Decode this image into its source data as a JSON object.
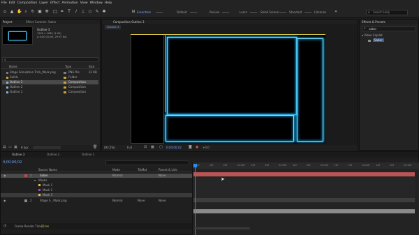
{
  "menu": [
    "File",
    "Edit",
    "Composition",
    "Layer",
    "Effect",
    "Animation",
    "View",
    "Window",
    "Help"
  ],
  "workspaces": [
    "Essentials",
    "Default",
    "Review",
    "Learn",
    "Small Screen",
    "Standard",
    "Libraries"
  ],
  "search_help_placeholder": "Search Help",
  "project_panel": {
    "tab": "Project",
    "effect_controls_tab": "Effect Controls: Saber",
    "selected_item_name": "Outline 3",
    "selected_item_info_1": "1920 x 1080 (1.00)",
    "selected_item_info_2": "Δ 0;00;10;00, 29.97 fps",
    "columns": {
      "name": "Name",
      "type": "Type",
      "size": "Size"
    },
    "items": [
      {
        "name": "Stage Simulation Trick_Mask.png",
        "type": "PNG file",
        "size": "22 KB",
        "color": "#7c7c7c"
      },
      {
        "name": "Solids",
        "type": "Folder",
        "size": "",
        "color": "#c9a33a"
      },
      {
        "name": "Outline 3",
        "type": "Composition",
        "size": "",
        "color": "#c9a33a",
        "selected": true
      },
      {
        "name": "Outline 2",
        "type": "Composition",
        "size": "",
        "color": "#c9a33a"
      },
      {
        "name": "Outline 1",
        "type": "Composition",
        "size": "",
        "color": "#c9a33a"
      }
    ],
    "bpc": "8 bpc"
  },
  "composition_panel": {
    "tab": "Composition Outline 3",
    "sub_tab": "Outline 3",
    "zoom": "(93.5%)",
    "resolution": "Full",
    "time": "0;00;00;02",
    "exposure": "+0.0"
  },
  "effects_panel": {
    "tab": "Effects & Presets",
    "search_value": "saber",
    "category": "Video Copilot",
    "effect": "Saber"
  },
  "timeline": {
    "tabs": [
      "Outline 3",
      "Outline 2",
      "Outline 1"
    ],
    "current_time": "0;00;00;02",
    "columns": {
      "source": "Source Name",
      "mode": "Mode",
      "trkmat": "TrkMat",
      "parent": "Parent & Link"
    },
    "layers": [
      {
        "num": "1",
        "name": "Saber",
        "mode": "Normal",
        "trkmat": "",
        "parent": "None",
        "color": "#c04a4a",
        "selected": true
      },
      {
        "num": "",
        "name": "Masks",
        "mode": "",
        "trkmat": "",
        "parent": "",
        "color": ""
      },
      {
        "num": "",
        "name": "Mask 1",
        "mode": "",
        "trkmat": "",
        "parent": "",
        "color": "#d7c44a"
      },
      {
        "num": "",
        "name": "Mask 2",
        "mode": "",
        "trkmat": "",
        "parent": "",
        "color": "#a64ac0"
      },
      {
        "num": "",
        "name": "Mask 3",
        "mode": "",
        "trkmat": "",
        "parent": "",
        "color": "#d7c44a"
      },
      {
        "num": "2",
        "name": "Stage S…Mask.png",
        "mode": "Normal",
        "trkmat": "None",
        "parent": "None",
        "color": "#8a8a8a"
      }
    ],
    "ruler_ticks": [
      "00f",
      "10f",
      "20f",
      "01:00f",
      "10f",
      "20f",
      "02:00f",
      "10f",
      "20f",
      "03:00f",
      "10f",
      "20f",
      "04:00f",
      "10f",
      "20f",
      "05:00f"
    ],
    "playhead_fraction": 0.006,
    "render_time_label": "Frame Render Time:",
    "render_time_value": "21ms"
  },
  "colors": {
    "accent": "#2d8ceb",
    "layer_red": "#b85454",
    "layer_gray": "#8a8a8a",
    "glow": "#19a7e0"
  }
}
